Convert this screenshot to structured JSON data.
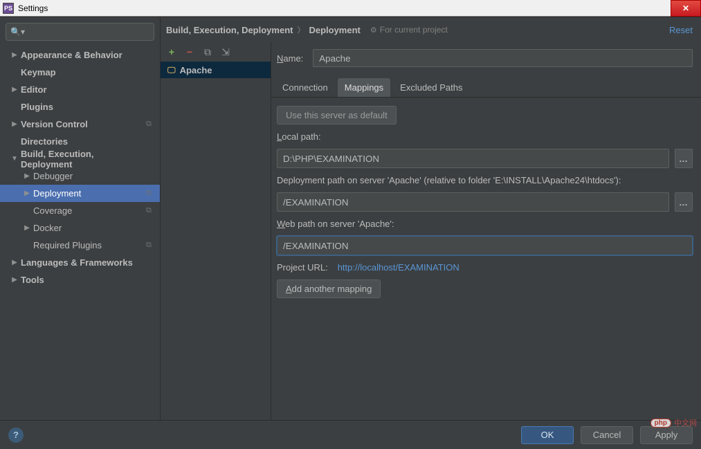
{
  "window": {
    "title": "Settings"
  },
  "titlebar_buttons": {
    "close_glyph": "✕"
  },
  "search": {
    "placeholder": "",
    "glyph": "🔍▾"
  },
  "sidebar": {
    "items": [
      {
        "label": "Appearance & Behavior",
        "bold": true,
        "arrow": "right",
        "indent": 0
      },
      {
        "label": "Keymap",
        "bold": true,
        "arrow": "",
        "indent": 0,
        "noarrow": true
      },
      {
        "label": "Editor",
        "bold": true,
        "arrow": "right",
        "indent": 0
      },
      {
        "label": "Plugins",
        "bold": true,
        "arrow": "",
        "indent": 0,
        "noarrow": true
      },
      {
        "label": "Version Control",
        "bold": true,
        "arrow": "right",
        "indent": 0,
        "extra": "⧉"
      },
      {
        "label": "Directories",
        "bold": true,
        "arrow": "",
        "indent": 0,
        "noarrow": true
      },
      {
        "label": "Build, Execution, Deployment",
        "bold": true,
        "arrow": "down",
        "indent": 0
      },
      {
        "label": "Debugger",
        "bold": false,
        "arrow": "right",
        "indent": 1
      },
      {
        "label": "Deployment",
        "bold": false,
        "arrow": "right",
        "indent": 1,
        "selected": true,
        "extra": "⧉"
      },
      {
        "label": "Coverage",
        "bold": false,
        "arrow": "",
        "indent": 1,
        "noarrow": true,
        "extra": "⧉"
      },
      {
        "label": "Docker",
        "bold": false,
        "arrow": "right",
        "indent": 1
      },
      {
        "label": "Required Plugins",
        "bold": false,
        "arrow": "",
        "indent": 1,
        "noarrow": true,
        "extra": "⧉"
      },
      {
        "label": "Languages & Frameworks",
        "bold": true,
        "arrow": "right",
        "indent": 0
      },
      {
        "label": "Tools",
        "bold": true,
        "arrow": "right",
        "indent": 0
      }
    ]
  },
  "breadcrumb": {
    "a": "Build, Execution, Deployment",
    "b": "Deployment",
    "scope": "For current project",
    "reset": "Reset"
  },
  "servers": {
    "toolbar": {
      "add": "+",
      "remove": "−",
      "copy": "⧉",
      "export": "⇲"
    },
    "items": [
      {
        "name": "Apache"
      }
    ]
  },
  "form": {
    "name_label_pre": "N",
    "name_label_post": "ame:",
    "name_value": "Apache",
    "tabs": {
      "connection": "Connection",
      "mappings": "Mappings",
      "excluded": "Excluded Paths"
    },
    "default_btn": "Use this server as default",
    "local_label_pre": "L",
    "local_label_post": "ocal path:",
    "local_value": "D:\\PHP\\EXAMINATION",
    "deploy_label": "Deployment path on server 'Apache' (relative to folder 'E:\\INSTALL\\Apache24\\htdocs'):",
    "deploy_value": "/EXAMINATION",
    "web_label_pre": "W",
    "web_label_post": "eb path on server 'Apache':",
    "web_value": "/EXAMINATION",
    "proj_url_label": "Project URL:",
    "proj_url_value": "http://localhost/EXAMINATION",
    "add_mapping_pre": "A",
    "add_mapping_post": "dd another mapping",
    "dots": "…"
  },
  "footer": {
    "ok": "OK",
    "cancel": "Cancel",
    "apply": "Apply",
    "help": "?"
  },
  "watermark": {
    "badge": "php",
    "text": "中文网"
  }
}
